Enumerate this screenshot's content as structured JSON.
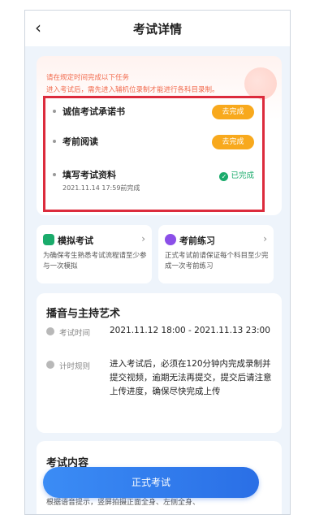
{
  "header": {
    "back_icon": "chevron-left-icon",
    "title": "考试详情"
  },
  "tasks": {
    "notice_line1": "请在规定时间完成以下任务",
    "notice_line2": "进入考试后，需先进入辅机位录制才能进行各科目录制。",
    "items": [
      {
        "name": "诚信考试承诺书",
        "action": "去完成"
      },
      {
        "name": "考前阅读",
        "action": "去完成"
      },
      {
        "name": "填写考试资料",
        "subtitle": "2021.11.14 17:59前完成",
        "status": "已完成"
      }
    ]
  },
  "cards": [
    {
      "title": "模拟考试",
      "icon": "mock-exam-icon",
      "desc": "为确保考生熟悉考试流程请至少参与一次模拟"
    },
    {
      "title": "考前练习",
      "icon": "practice-play-icon",
      "desc": "正式考试前请保证每个科目至少完成一次考前练习"
    }
  ],
  "exam": {
    "title": "播音与主持艺术",
    "time_label": "考试时间",
    "time_value": "2021.11.12 18:00 - 2021.11.13 23:00",
    "rule_label": "计时规则",
    "rule_value": "进入考试后，必须在120分钟内完成录制并提交视频，逾期无法再提交，提交后请注意上传进度，确保尽快完成上传"
  },
  "content": {
    "title": "考试内容",
    "desc": "根据语音提示，竖屏拍摄正面全身、左侧全身、",
    "start_button": "正式考试"
  },
  "colors": {
    "accent": "#2a6fe6",
    "warning": "#f8a91d",
    "success": "#1aab6b",
    "highlight_border": "#dc2b3c"
  }
}
